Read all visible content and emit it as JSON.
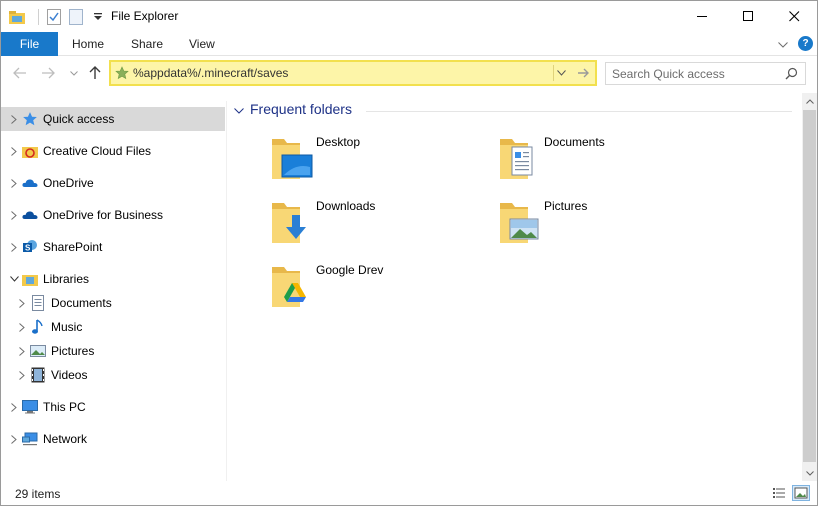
{
  "window": {
    "title": "File Explorer"
  },
  "ribbon": {
    "tabs": [
      {
        "label": "File"
      },
      {
        "label": "Home"
      },
      {
        "label": "Share"
      },
      {
        "label": "View"
      }
    ],
    "help_label": "?"
  },
  "address": {
    "value": "%appdata%/.minecraft/saves"
  },
  "search": {
    "placeholder": "Search Quick access"
  },
  "nav": {
    "items": [
      {
        "label": "Quick access",
        "icon": "star-icon",
        "selected": true
      },
      {
        "label": "Creative Cloud Files",
        "icon": "creative-cloud-icon"
      },
      {
        "label": "OneDrive",
        "icon": "onedrive-icon"
      },
      {
        "label": "OneDrive for Business",
        "icon": "onedrive-business-icon"
      },
      {
        "label": "SharePoint",
        "icon": "sharepoint-icon"
      },
      {
        "label": "Libraries",
        "icon": "libraries-icon",
        "expanded": true
      },
      {
        "label": "Documents",
        "icon": "documents-icon"
      },
      {
        "label": "Music",
        "icon": "music-icon"
      },
      {
        "label": "Pictures",
        "icon": "pictures-icon"
      },
      {
        "label": "Videos",
        "icon": "videos-icon"
      },
      {
        "label": "This PC",
        "icon": "computer-icon"
      },
      {
        "label": "Network",
        "icon": "network-icon"
      }
    ]
  },
  "content": {
    "group_title": "Frequent folders",
    "folders": [
      {
        "label": "Desktop",
        "icon": "desktop-folder-icon"
      },
      {
        "label": "Documents",
        "icon": "documents-folder-icon"
      },
      {
        "label": "Downloads",
        "icon": "downloads-folder-icon"
      },
      {
        "label": "Pictures",
        "icon": "pictures-folder-icon"
      },
      {
        "label": "Google Drev",
        "icon": "google-drive-folder-icon"
      }
    ]
  },
  "status": {
    "item_count": "29 items"
  },
  "colors": {
    "accent": "#1979ca",
    "address_highlight": "#fdf5a8",
    "address_border": "#f2e04e",
    "group_header": "#1e3287",
    "selection": "#d9d9d9",
    "folder": "#f8d775"
  }
}
